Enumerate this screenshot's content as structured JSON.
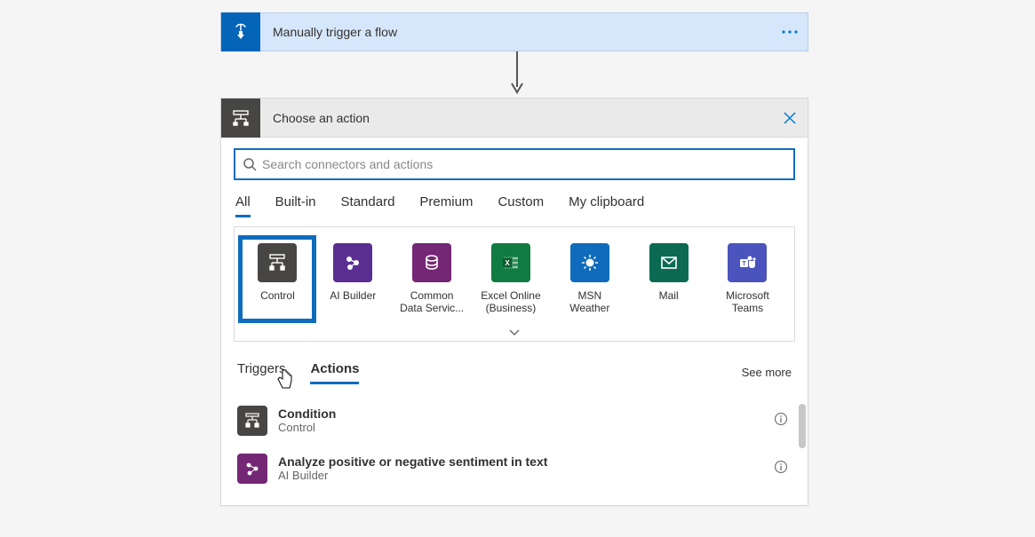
{
  "trigger": {
    "title": "Manually trigger a flow"
  },
  "chooser": {
    "title": "Choose an action",
    "search_placeholder": "Search connectors and actions"
  },
  "category_tabs": [
    "All",
    "Built-in",
    "Standard",
    "Premium",
    "Custom",
    "My clipboard"
  ],
  "category_active_index": 0,
  "connectors": [
    {
      "name": "Control",
      "label": "Control",
      "color": "#484644"
    },
    {
      "name": "AI Builder",
      "label": "AI Builder",
      "color": "#5b2e91"
    },
    {
      "name": "Common Data Service",
      "label": "Common\nData Servic...",
      "color": "#742774"
    },
    {
      "name": "Excel Online Business",
      "label": "Excel Online\n(Business)",
      "color": "#107c41"
    },
    {
      "name": "MSN Weather",
      "label": "MSN\nWeather",
      "color": "#0f6cbd"
    },
    {
      "name": "Mail",
      "label": "Mail",
      "color": "#0b6a51"
    },
    {
      "name": "Microsoft Teams",
      "label": "Microsoft\nTeams",
      "color": "#4b53bc"
    }
  ],
  "connector_selected_index": 0,
  "section_tabs": [
    "Triggers",
    "Actions"
  ],
  "section_active_index": 1,
  "see_more": "See more",
  "results": [
    {
      "title": "Condition",
      "subtitle": "Control",
      "color": "#484644"
    },
    {
      "title": "Analyze positive or negative sentiment in text",
      "subtitle": "AI Builder",
      "color": "#742774"
    }
  ]
}
